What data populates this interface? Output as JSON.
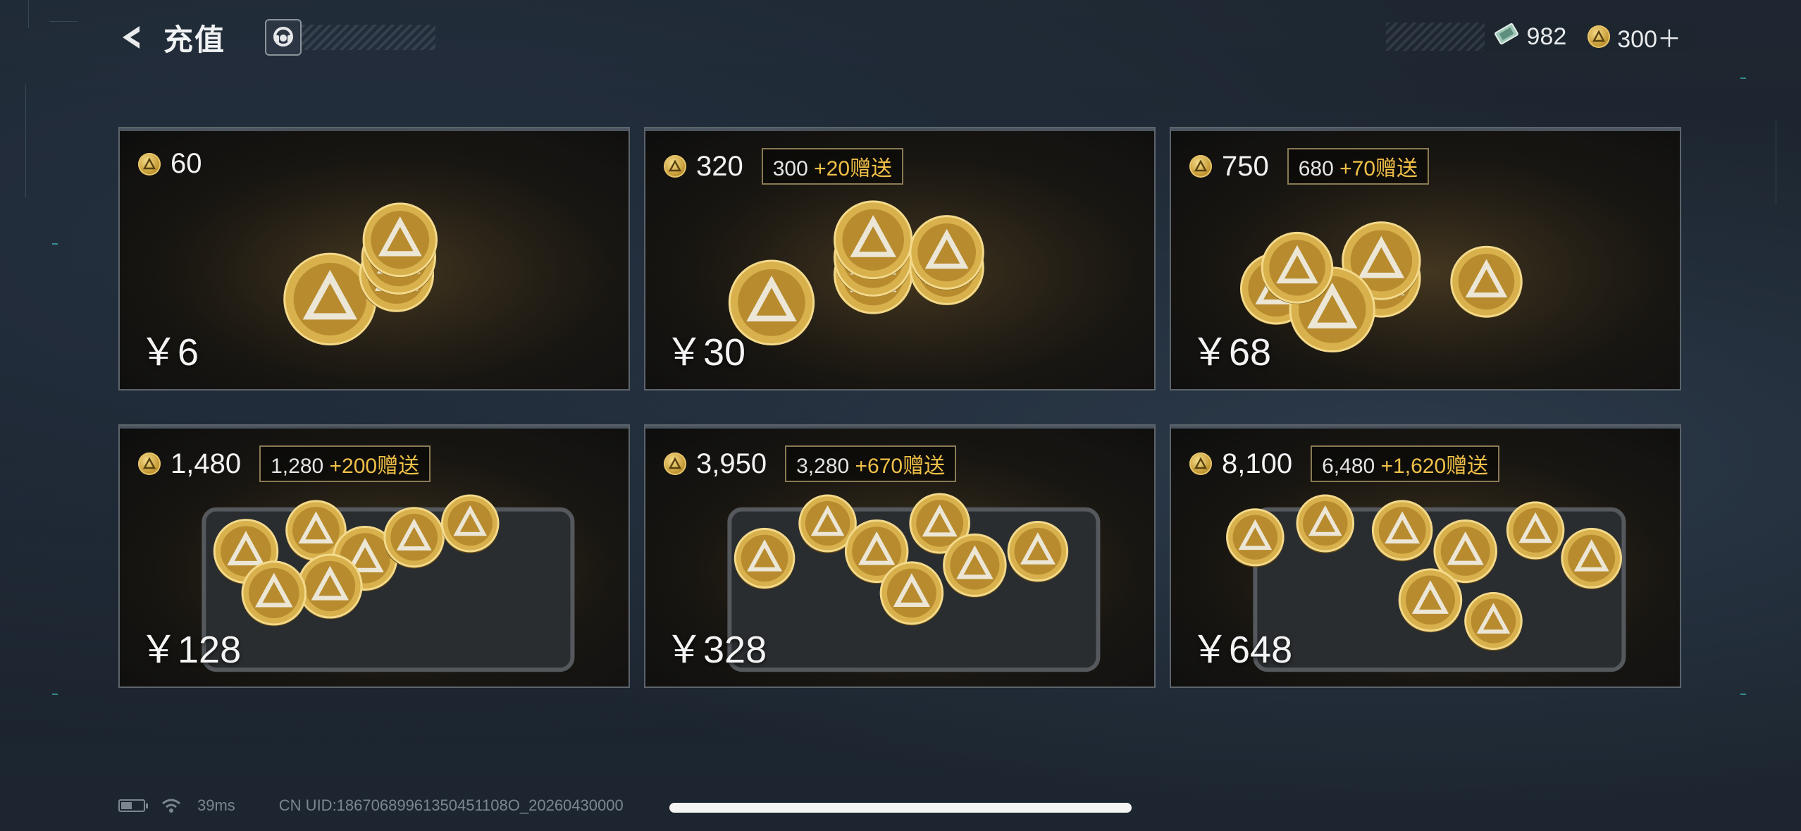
{
  "header": {
    "title": "充值"
  },
  "wallet": {
    "tickets": "982",
    "coins": "300＋"
  },
  "packages": [
    {
      "amount": "60",
      "bonus_base": "",
      "bonus_plus": "",
      "price": "￥6"
    },
    {
      "amount": "320",
      "bonus_base": "300",
      "bonus_plus": "+20赠送",
      "price": "￥30"
    },
    {
      "amount": "750",
      "bonus_base": "680",
      "bonus_plus": "+70赠送",
      "price": "￥68"
    },
    {
      "amount": "1,480",
      "bonus_base": "1,280",
      "bonus_plus": "+200赠送",
      "price": "￥128"
    },
    {
      "amount": "3,950",
      "bonus_base": "3,280",
      "bonus_plus": "+670赠送",
      "price": "￥328"
    },
    {
      "amount": "8,100",
      "bonus_base": "6,480",
      "bonus_plus": "+1,620赠送",
      "price": "￥648"
    }
  ],
  "status": {
    "battery_level": 0.5,
    "ping": "39ms",
    "uid": "CN UID:18670689961350451108O_20260430000"
  },
  "colors": {
    "accent_gold": "#f0c048",
    "hud_teal": "#3fb6b3"
  }
}
